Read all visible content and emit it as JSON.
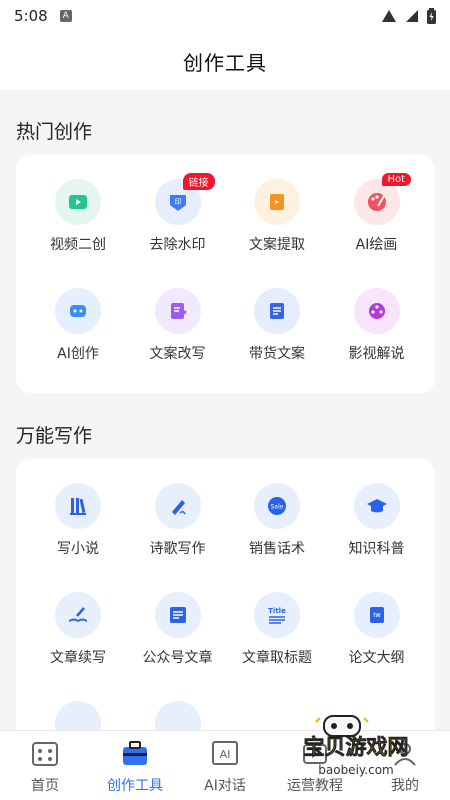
{
  "status_bar": {
    "time": "5:08",
    "notification_letter": "A"
  },
  "header": {
    "title": "创作工具"
  },
  "hot_section": {
    "title": "热门创作",
    "items": [
      {
        "label": "视频二创",
        "icon": "video-play-icon",
        "color": "#22c58b",
        "bg": "#e3f7ee"
      },
      {
        "label": "去除水印",
        "icon": "remove-watermark-icon",
        "color": "#3d7cf5",
        "bg": "#e6eefd",
        "badge": "链接"
      },
      {
        "label": "文案提取",
        "icon": "text-extract-icon",
        "color": "#f6941e",
        "bg": "#fff1e0"
      },
      {
        "label": "AI绘画",
        "icon": "palette-icon",
        "color": "#f0525f",
        "bg": "#fde7e9",
        "badge": "Hot"
      },
      {
        "label": "AI创作",
        "icon": "robot-icon",
        "color": "#3a8df5",
        "bg": "#e4f0fe"
      },
      {
        "label": "文案改写",
        "icon": "edit-doc-icon",
        "color": "#9b5cf2",
        "bg": "#f1e9fd"
      },
      {
        "label": "带货文案",
        "icon": "document-icon",
        "color": "#3565e5",
        "bg": "#e5ecfc"
      },
      {
        "label": "影视解说",
        "icon": "film-reel-icon",
        "color": "#b23ad8",
        "bg": "#f6e5fb"
      }
    ]
  },
  "writing_section": {
    "title": "万能写作",
    "items": [
      {
        "label": "写小说",
        "icon": "books-icon",
        "color": "#2a63e8",
        "bg": "#e7eefc"
      },
      {
        "label": "诗歌写作",
        "icon": "pen-icon",
        "color": "#2a63e8",
        "bg": "#e7eefc"
      },
      {
        "label": "销售话术",
        "icon": "sale-tag-icon",
        "color": "#2a63e8",
        "bg": "#e7eefc",
        "tag_text": "Sale"
      },
      {
        "label": "知识科普",
        "icon": "graduation-cap-icon",
        "color": "#2a63e8",
        "bg": "#e7eefc"
      },
      {
        "label": "文章续写",
        "icon": "open-book-pen-icon",
        "color": "#2a63e8",
        "bg": "#e7eefc"
      },
      {
        "label": "公众号文章",
        "icon": "article-icon",
        "color": "#2a63e8",
        "bg": "#e7eefc"
      },
      {
        "label": "文章取标题",
        "icon": "title-icon",
        "color": "#2a63e8",
        "bg": "#e7eefc",
        "tag_text": "Title"
      },
      {
        "label": "论文大纲",
        "icon": "paper-outline-icon",
        "color": "#2a63e8",
        "bg": "#e7eefc",
        "tag_text": "Iw"
      }
    ]
  },
  "bottom_nav": [
    {
      "label": "首页",
      "icon": "home-grid-icon",
      "active": false
    },
    {
      "label": "创作工具",
      "icon": "toolbox-icon",
      "active": true
    },
    {
      "label": "AI对话",
      "icon": "ai-chat-icon",
      "active": false,
      "icon_text": "AI"
    },
    {
      "label": "运营教程",
      "icon": "tutorial-icon",
      "active": false
    },
    {
      "label": "我的",
      "icon": "profile-icon",
      "active": false
    }
  ],
  "watermark": {
    "text": "宝贝游戏网",
    "url": "baobeiy.com"
  },
  "colors": {
    "accent": "#2f6ff6",
    "badge": "#f0162b",
    "page_bg": "#f4f5f7"
  }
}
